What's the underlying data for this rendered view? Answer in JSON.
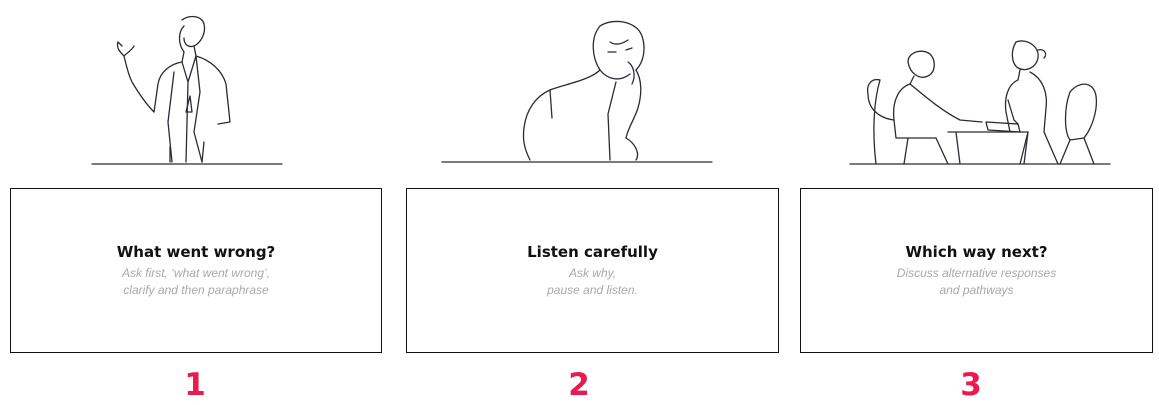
{
  "steps": [
    {
      "number": "1",
      "title": "What went wrong?",
      "subtitle_lines": [
        "Ask first, ‘what went wrong’,",
        "clarify and then paraphrase"
      ],
      "illustration_icon": "presenter-icon"
    },
    {
      "number": "2",
      "title": "Listen carefully",
      "subtitle_lines": [
        "Ask why,",
        "pause and listen."
      ],
      "illustration_icon": "listener-icon"
    },
    {
      "number": "3",
      "title": "Which way next?",
      "subtitle_lines": [
        "Discuss alternative responses",
        "and pathways"
      ],
      "illustration_icon": "meeting-icon"
    }
  ],
  "colors": {
    "number": "#ea1a4e",
    "title": "#111111",
    "subtitle": "#a9a9a9",
    "line_art": "#2a2a3a"
  }
}
